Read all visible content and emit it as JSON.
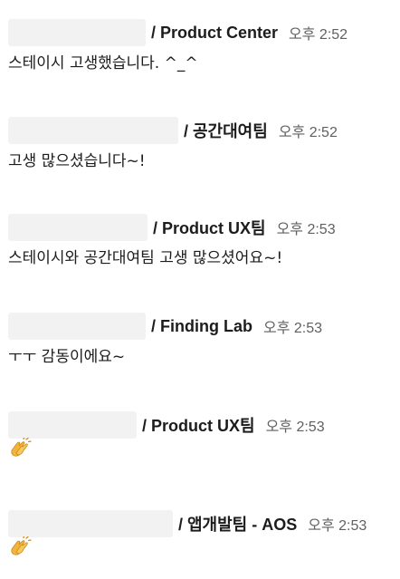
{
  "messages": [
    {
      "team": "/ Product Center",
      "time": "오후 2:52",
      "text": "스테이시 고생했습니다. ^_^",
      "name_box_color": "#f2f2f2"
    },
    {
      "team": "/ 공간대여팀",
      "time": "오후 2:52",
      "text": "고생 많으셨습니다~!",
      "name_box_color": "#f2f2f2"
    },
    {
      "team": "/ Product UX팀",
      "time": "오후 2:53",
      "text": "스테이시와 공간대여팀 고생 많으셨어요~!",
      "name_box_color": "#f2f2f2"
    },
    {
      "team": "/ Finding Lab",
      "time": "오후 2:53",
      "text": "ㅜㅜ 감동이에요~",
      "name_box_color": "#f2f2f2"
    },
    {
      "team": "/ Product UX팀",
      "time": "오후 2:53",
      "emoji": "clapping-hands",
      "name_box_color": "#f2f2f2"
    },
    {
      "team": "/ 앱개발팀 - AOS",
      "time": "오후 2:53",
      "emoji": "clapping-hands",
      "name_box_color": "#f2f2f2"
    }
  ]
}
